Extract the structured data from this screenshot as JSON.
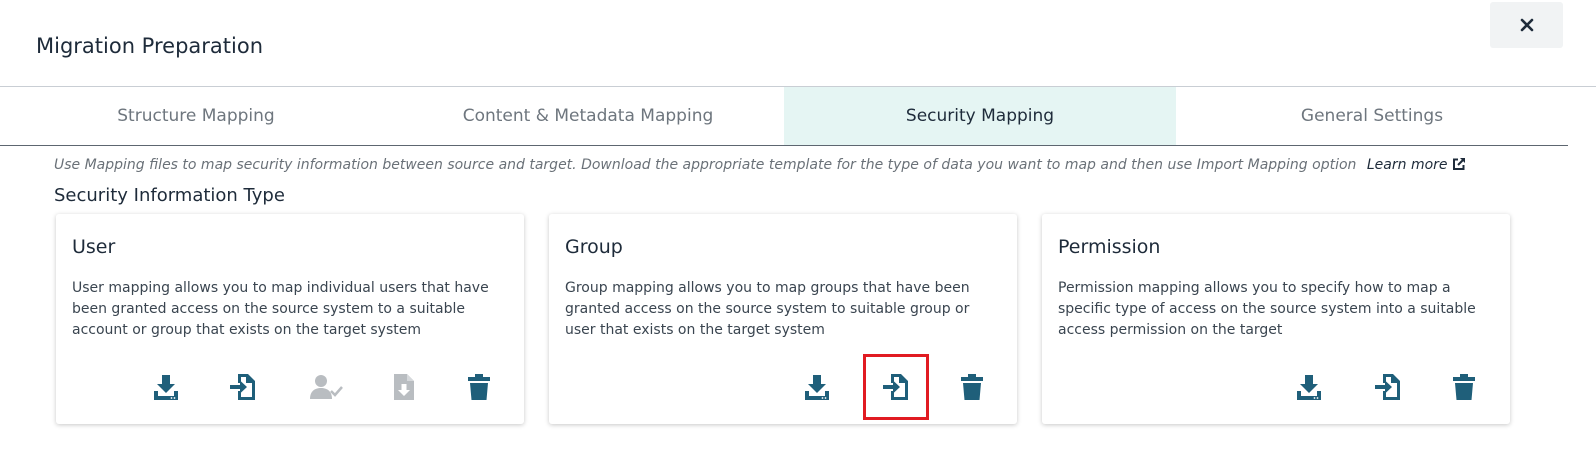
{
  "dialog": {
    "title": "Migration Preparation"
  },
  "tabs": [
    {
      "label": "Structure Mapping",
      "active": false
    },
    {
      "label": "Content & Metadata Mapping",
      "active": false
    },
    {
      "label": "Security Mapping",
      "active": true
    },
    {
      "label": "General Settings",
      "active": false
    }
  ],
  "description": {
    "text": "Use Mapping files to map security information between source and target.  Download the appropriate template for the type of data you want to map and then use Import Mapping option",
    "learn_more": "Learn more"
  },
  "section": {
    "title": "Security Information Type"
  },
  "cards": [
    {
      "title": "User",
      "description": "User mapping allows you to map individual users that have been granted access on the source system to a suitable account or group that exists on the target system",
      "actions": [
        "download-template-icon",
        "import-mapping-icon",
        "user-check-icon",
        "export-file-icon",
        "delete-icon"
      ]
    },
    {
      "title": "Group",
      "description": "Group mapping allows you to map groups that have been granted access on the source system to suitable group or user that exists on the target system",
      "actions": [
        "download-template-icon",
        "import-mapping-icon",
        "delete-icon"
      ]
    },
    {
      "title": "Permission",
      "description": "Permission mapping allows you to specify how to map a specific type of access on the source system into a suitable access permission on the target",
      "actions": [
        "download-template-icon",
        "import-mapping-icon",
        "delete-icon"
      ]
    }
  ],
  "colors": {
    "icon_active": "#1f5f7a",
    "icon_disabled": "#b9bdc1",
    "tab_active_bg": "#e5f5f3",
    "highlight": "#e11b22"
  }
}
